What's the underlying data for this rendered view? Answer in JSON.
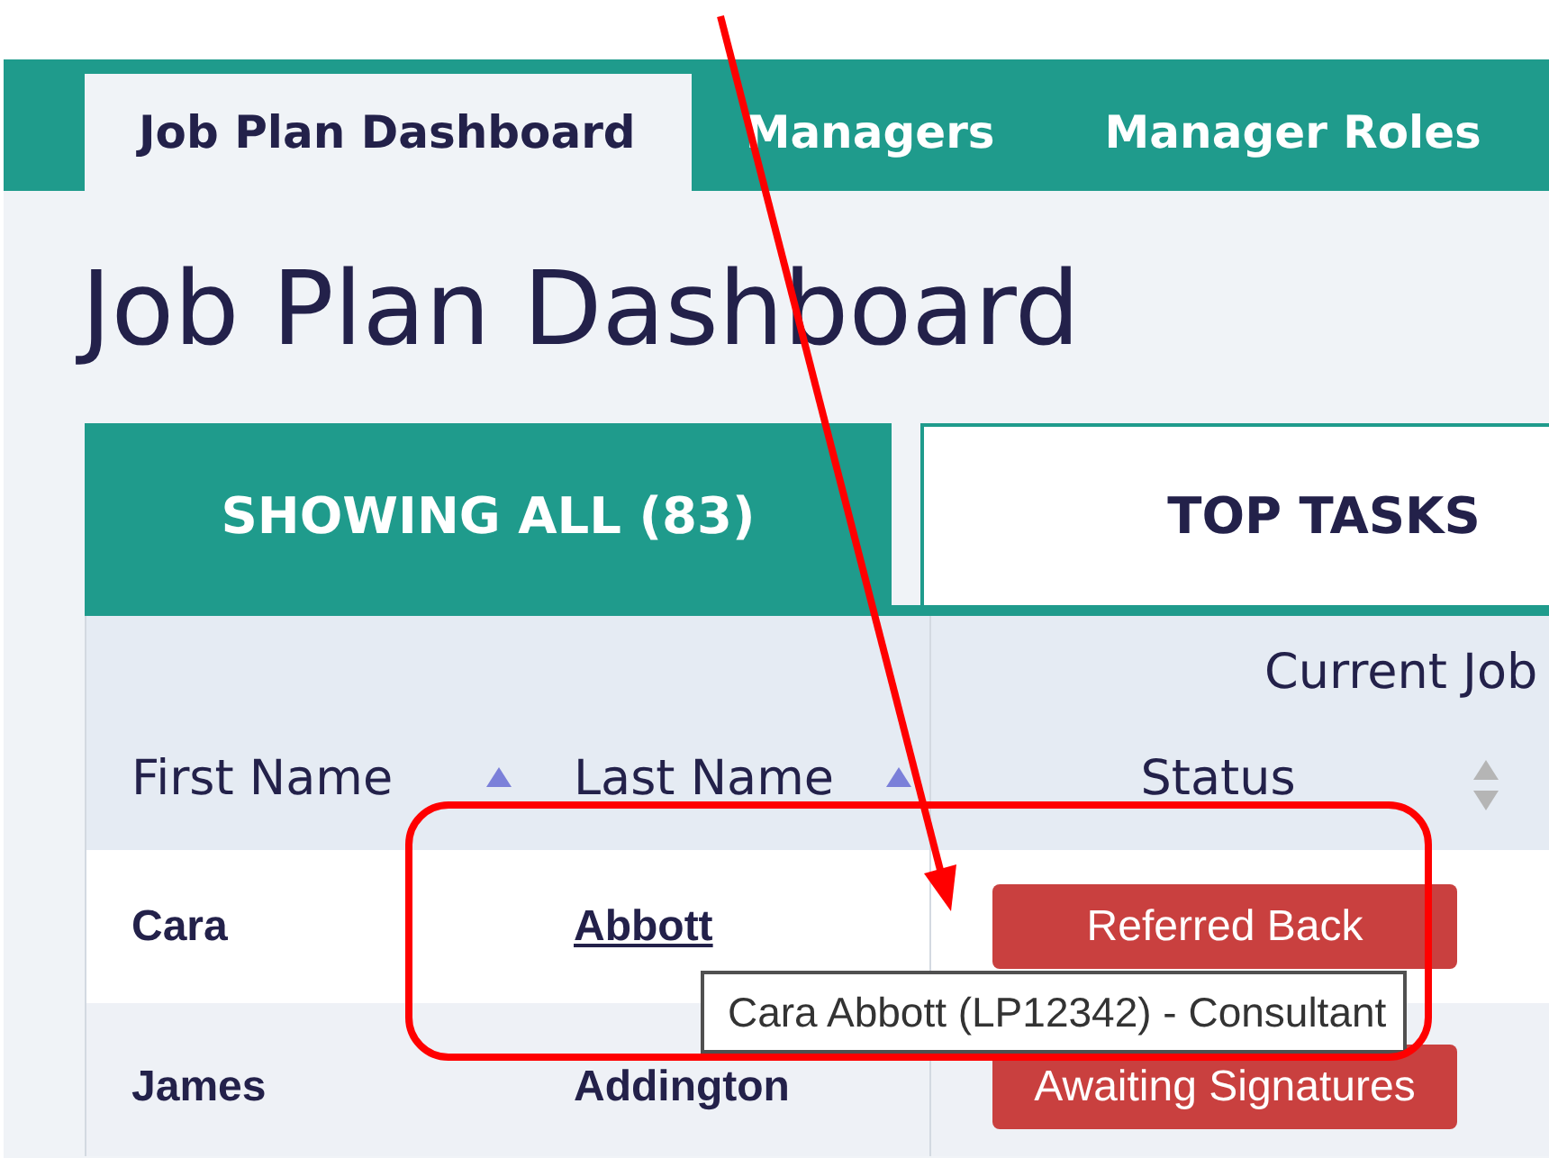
{
  "nav_tabs": [
    {
      "label": "Job Plan Dashboard",
      "selected": true
    },
    {
      "label": "Managers",
      "selected": false
    },
    {
      "label": "Manager Roles",
      "selected": false
    }
  ],
  "page_title": "Job Plan Dashboard",
  "view_tabs": [
    {
      "label": "SHOWING ALL (83)",
      "selected": true
    },
    {
      "label": "TOP TASKS",
      "selected": false
    }
  ],
  "table": {
    "group_header": "Current Job",
    "columns": [
      {
        "label": "First Name",
        "sorted_ascending": true
      },
      {
        "label": "Last Name",
        "sorted_ascending": true
      },
      {
        "label": "Status",
        "sorted_ascending": false
      }
    ],
    "rows": [
      {
        "first_name": "Cara",
        "last_name": "Abbott",
        "last_name_hovered": true,
        "status": "Referred Back"
      },
      {
        "first_name": "James",
        "last_name": "Addington",
        "last_name_hovered": false,
        "status": "Awaiting Signatures"
      }
    ]
  },
  "tooltip": {
    "text": "Cara Abbott (LP12342) - Consultant"
  }
}
